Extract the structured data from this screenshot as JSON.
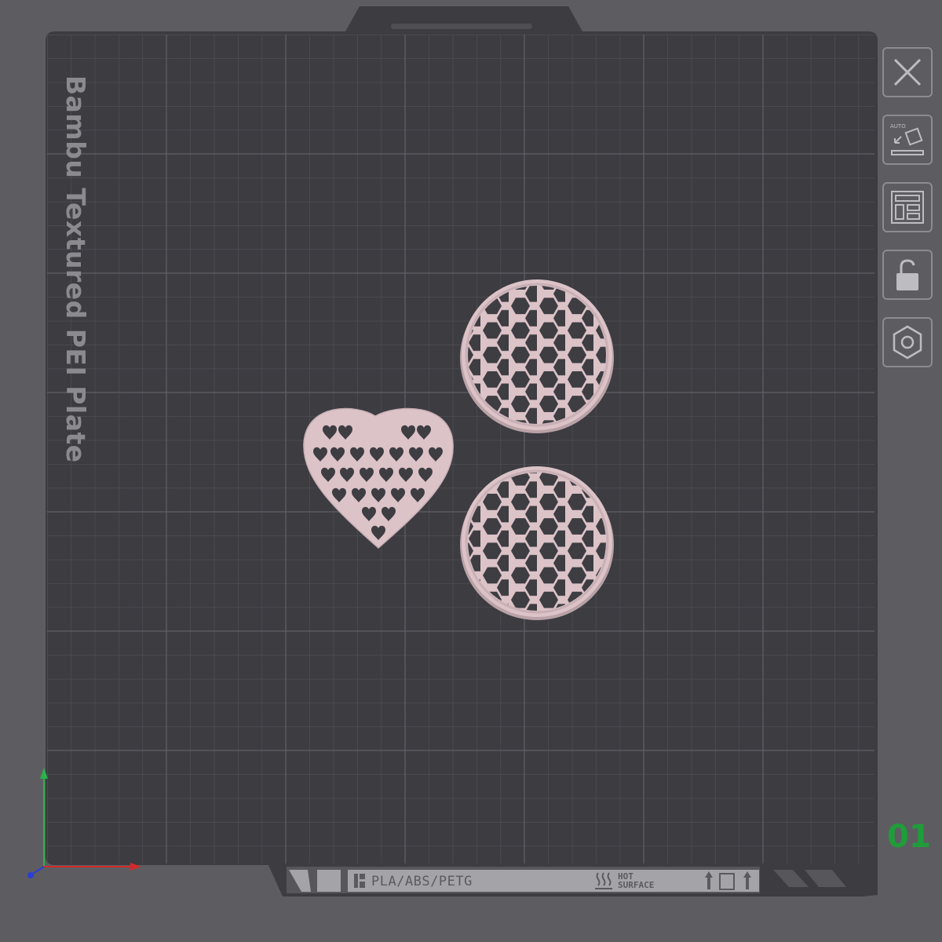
{
  "plate": {
    "label": "Bambu Textured PEI Plate",
    "number": "01",
    "material_strip": "PLA/ABS/PETG",
    "hot_surface_line1": "HOT",
    "hot_surface_line2": "SURFACE"
  },
  "toolbar": {
    "buttons": [
      {
        "name": "close-button",
        "icon": "close-icon"
      },
      {
        "name": "auto-orient-button",
        "icon": "auto-orient-icon",
        "text": "AUTO"
      },
      {
        "name": "arrange-button",
        "icon": "arrange-icon"
      },
      {
        "name": "lock-button",
        "icon": "unlock-icon"
      },
      {
        "name": "plate-settings-button",
        "icon": "hexagon-nut-icon"
      }
    ]
  },
  "models": [
    {
      "name": "heart-lattice-model",
      "shape": "heart-with-heart-cutouts"
    },
    {
      "name": "honeycomb-disc-model-1",
      "shape": "circle-with-hexagon-mesh"
    },
    {
      "name": "honeycomb-disc-model-2",
      "shape": "circle-with-hexagon-mesh"
    }
  ],
  "axes": {
    "x_color": "#d12a2a",
    "y_color": "#2bb34a",
    "z_color": "#2c3ed6"
  },
  "colors": {
    "background": "#5d5d61",
    "plate": "#3d3d42",
    "grid": "#54545a",
    "model": "#dcc3c8",
    "plate_number": "#1f9d3a"
  }
}
